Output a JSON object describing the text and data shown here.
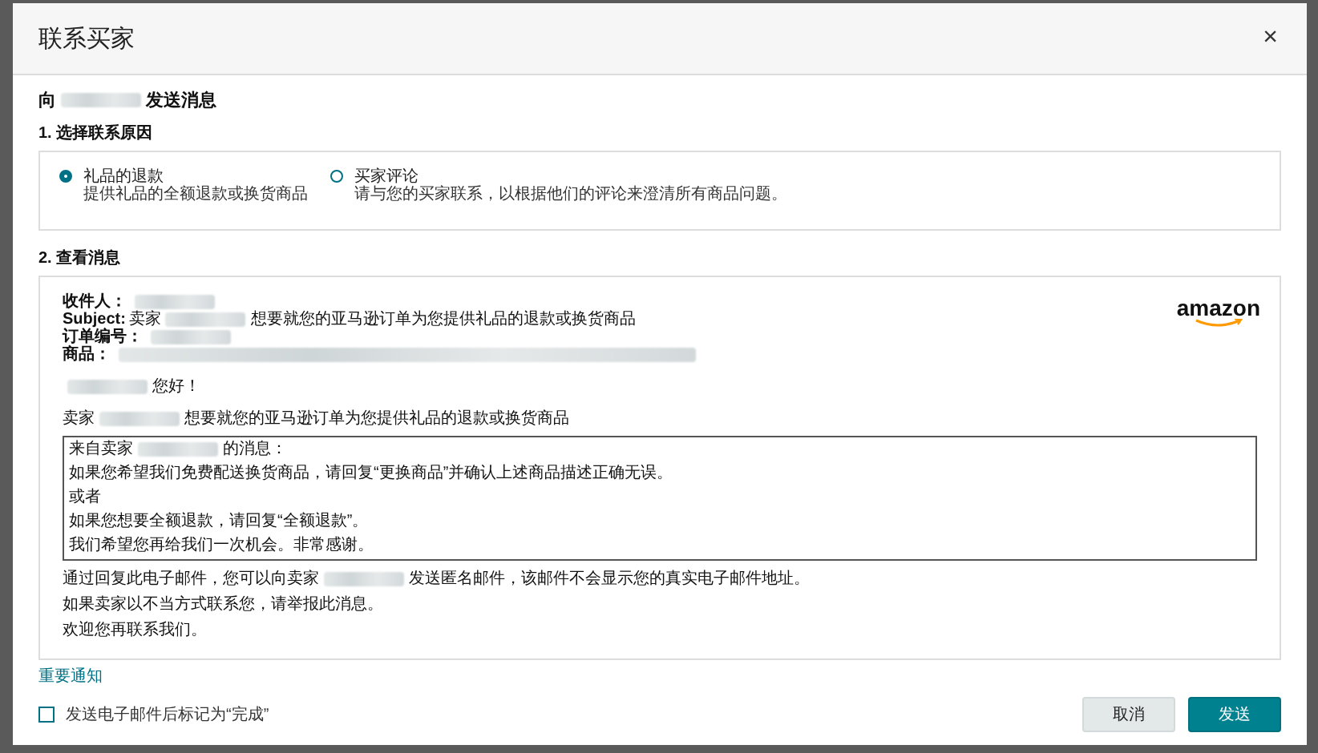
{
  "dialog": {
    "title": "联系买家",
    "close": "×"
  },
  "heading": [
    {
      "kind": "text",
      "text": "向"
    },
    {
      "kind": "redacted"
    },
    {
      "kind": "text",
      "text": "发送消息"
    }
  ],
  "reason_section": {
    "title": "1. 选择联系原因",
    "options": [
      {
        "label": "礼品的退款",
        "description": "提供礼品的全额退款或换货商品",
        "selected": true
      },
      {
        "label": "买家评论",
        "description": "请与您的买家联系，以根据他们的评论来澄清所有商品问题。",
        "selected": false
      }
    ]
  },
  "message_section": {
    "title": "2. 查看消息",
    "logo": "amazon",
    "fields": [
      [
        {
          "kind": "label",
          "text": "收件人："
        },
        {
          "kind": "redacted"
        }
      ],
      [
        {
          "kind": "label",
          "text": "Subject:"
        },
        {
          "kind": "text",
          "text": "卖家"
        },
        {
          "kind": "redacted"
        },
        {
          "kind": "text",
          "text": "想要就您的亚马逊订单为您提供礼品的退款或换货商品"
        }
      ],
      [
        {
          "kind": "label",
          "text": "订单编号："
        },
        {
          "kind": "redacted"
        }
      ],
      [
        {
          "kind": "label",
          "text": "商品："
        },
        {
          "kind": "redacted_wide"
        }
      ]
    ],
    "greeting": [
      {
        "kind": "redacted"
      },
      {
        "kind": "text",
        "text": "您好！"
      }
    ],
    "intro": [
      {
        "kind": "text",
        "text": "卖家"
      },
      {
        "kind": "redacted"
      },
      {
        "kind": "text",
        "text": "想要就您的亚马逊订单为您提供礼品的退款或换货商品"
      }
    ],
    "quote": {
      "header": [
        {
          "kind": "text",
          "text": "来自卖家"
        },
        {
          "kind": "redacted"
        },
        {
          "kind": "text",
          "text": "的消息："
        }
      ],
      "paragraphs": [
        "如果您希望我们免费配送换货商品，请回复“更换商品”并确认上述商品描述正确无误。",
        "或者",
        "如果您想要全额退款，请回复“全额退款”。",
        "我们希望您再给我们一次机会。非常感谢。"
      ]
    },
    "closing": [
      [
        {
          "kind": "text",
          "text": "通过回复此电子邮件，您可以向卖家"
        },
        {
          "kind": "redacted"
        },
        {
          "kind": "text",
          "text": "发送匿名邮件，该邮件不会显示您的真实电子邮件地址。"
        }
      ],
      [
        {
          "kind": "text",
          "text": "如果卖家以不当方式联系您，请举报此消息。"
        }
      ],
      [
        {
          "kind": "text",
          "text": "欢迎您再联系我们。"
        }
      ]
    ]
  },
  "notice_link": "重要通知",
  "mark_done": {
    "label": "发送电子邮件后标记为“完成”",
    "checked": false
  },
  "buttons": [
    {
      "label": "取消",
      "kind": "secondary"
    },
    {
      "label": "发送",
      "kind": "primary"
    }
  ]
}
